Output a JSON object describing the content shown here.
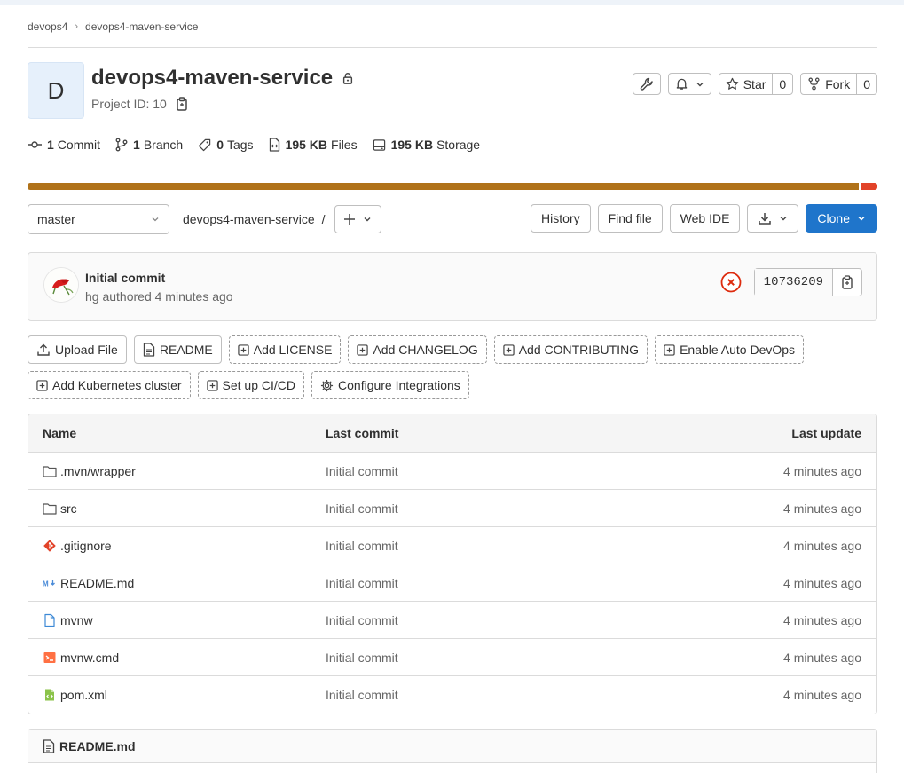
{
  "breadcrumb": {
    "group": "devops4",
    "project": "devops4-maven-service"
  },
  "project": {
    "avatar_letter": "D",
    "name": "devops4-maven-service",
    "id_label": "Project ID: 10"
  },
  "actions": {
    "star_label": "Star",
    "star_count": "0",
    "fork_label": "Fork",
    "fork_count": "0"
  },
  "stats": {
    "commits_num": "1",
    "commits_label": "Commit",
    "branches_num": "1",
    "branches_label": "Branch",
    "tags_num": "0",
    "tags_label": "Tags",
    "files_num": "195 KB",
    "files_label": "Files",
    "storage_num": "195 KB",
    "storage_label": "Storage"
  },
  "languages": [
    {
      "share": 0.98,
      "color": "#b07219"
    },
    {
      "share": 0.02,
      "color": "#e24329"
    }
  ],
  "treebar": {
    "branch": "master",
    "path": "devops4-maven-service",
    "slash": "/",
    "history": "History",
    "find_file": "Find file",
    "web_ide": "Web IDE",
    "clone": "Clone"
  },
  "commit": {
    "title": "Initial commit",
    "meta": "hg authored 4 minutes ago",
    "sha": "10736209"
  },
  "quick_actions": {
    "upload": "Upload File",
    "readme": "README",
    "license": "Add LICENSE",
    "changelog": "Add CHANGELOG",
    "contributing": "Add CONTRIBUTING",
    "autodevops": "Enable Auto DevOps",
    "kubernetes": "Add Kubernetes cluster",
    "cicd": "Set up CI/CD",
    "integrations": "Configure Integrations"
  },
  "files": {
    "headers": {
      "name": "Name",
      "commit": "Last commit",
      "update": "Last update"
    },
    "rows": [
      {
        "name": ".mvn/wrapper",
        "commit": "Initial commit",
        "update": "4 minutes ago",
        "icon": "folder-icon"
      },
      {
        "name": "src",
        "commit": "Initial commit",
        "update": "4 minutes ago",
        "icon": "folder-icon"
      },
      {
        "name": ".gitignore",
        "commit": "Initial commit",
        "update": "4 minutes ago",
        "icon": "git-icon"
      },
      {
        "name": "README.md",
        "commit": "Initial commit",
        "update": "4 minutes ago",
        "icon": "markdown-icon"
      },
      {
        "name": "mvnw",
        "commit": "Initial commit",
        "update": "4 minutes ago",
        "icon": "file-icon"
      },
      {
        "name": "mvnw.cmd",
        "commit": "Initial commit",
        "update": "4 minutes ago",
        "icon": "terminal-icon"
      },
      {
        "name": "pom.xml",
        "commit": "Initial commit",
        "update": "4 minutes ago",
        "icon": "xml-icon"
      }
    ]
  },
  "readme": {
    "title": "README.md"
  }
}
